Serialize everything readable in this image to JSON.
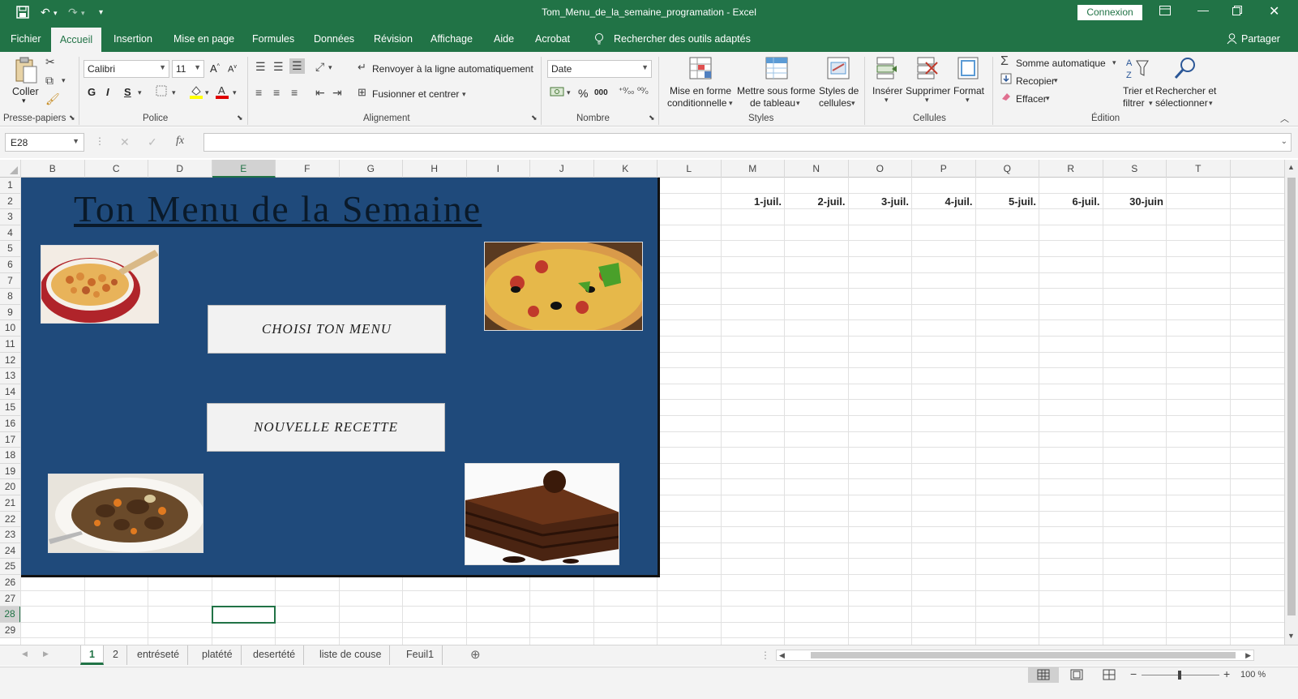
{
  "title_bar": {
    "document_title": "Tom_Menu_de_la_semaine_programation  -  Excel",
    "connexion_label": "Connexion",
    "save_icon": "save-icon",
    "undo_icon": "undo-icon",
    "redo_icon": "redo-icon"
  },
  "menu": {
    "tabs": [
      "Fichier",
      "Accueil",
      "Insertion",
      "Mise en page",
      "Formules",
      "Données",
      "Révision",
      "Affichage",
      "Aide",
      "Acrobat"
    ],
    "search_label": "Rechercher des outils adaptés",
    "share_label": "Partager"
  },
  "ribbon": {
    "clipboard": {
      "coller": "Coller",
      "group": "Presse-papiers"
    },
    "font": {
      "name": "Calibri",
      "size": "11",
      "bold": "G",
      "italic": "I",
      "underline": "S",
      "group": "Police"
    },
    "alignment": {
      "wrap": "Renvoyer à la ligne automatiquement",
      "merge": "Fusionner et centrer",
      "group": "Alignement"
    },
    "number": {
      "format": "Date",
      "percent": "%",
      "thousands": "000",
      "group": "Nombre"
    },
    "styles": {
      "conditional_1": "Mise en forme",
      "conditional_2": "conditionnelle",
      "table_1": "Mettre sous forme",
      "table_2": "de tableau",
      "cell_1": "Styles de",
      "cell_2": "cellules",
      "group": "Styles"
    },
    "cells": {
      "insert": "Insérer",
      "delete": "Supprimer",
      "format": "Format",
      "group": "Cellules"
    },
    "editing": {
      "autosum": "Somme automatique",
      "fill": "Recopier",
      "clear": "Effacer",
      "sort_1": "Trier et",
      "sort_2": "filtrer",
      "find_1": "Rechercher et",
      "find_2": "sélectionner",
      "group": "Édition"
    }
  },
  "formula_bar": {
    "name_box": "E28",
    "fx": "fx",
    "formula": ""
  },
  "grid": {
    "columns": [
      "B",
      "C",
      "D",
      "E",
      "F",
      "G",
      "H",
      "I",
      "J",
      "K",
      "L",
      "M",
      "N",
      "O",
      "P",
      "Q",
      "R",
      "S",
      "T"
    ],
    "rows": [
      "1",
      "2",
      "3",
      "4",
      "5",
      "6",
      "7",
      "8",
      "9",
      "10",
      "11",
      "12",
      "13",
      "14",
      "15",
      "16",
      "17",
      "18",
      "19",
      "20",
      "21",
      "22",
      "23",
      "24",
      "25",
      "26",
      "27",
      "28",
      "29"
    ],
    "dates": [
      "1-juil.",
      "2-juil.",
      "3-juil.",
      "4-juil.",
      "5-juil.",
      "6-juil.",
      "30-juin"
    ],
    "selected_cell": "E28"
  },
  "panel": {
    "title": "Ton Menu de la  Semaine",
    "button_choose": "CHOISI  TON  MENU",
    "button_new": "NOUVELLE RECETTE",
    "background_color": "#1f4a7b"
  },
  "sheets": {
    "tabs": [
      "1",
      "2",
      "entréseté",
      "platété",
      "desertété",
      "liste de couse",
      "Feuil1"
    ],
    "active": "1"
  },
  "status": {
    "zoom": "100 %"
  },
  "colors": {
    "excel_green": "#217346"
  }
}
